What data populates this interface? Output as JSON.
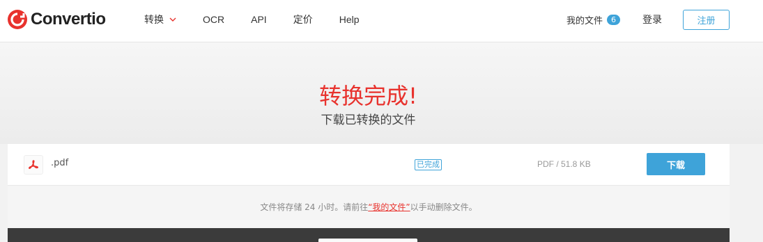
{
  "brand": {
    "name": "Convertio",
    "accent": "#e8322d"
  },
  "nav": {
    "items": [
      {
        "label": "转换",
        "has_dropdown": true
      },
      {
        "label": "OCR"
      },
      {
        "label": "API"
      },
      {
        "label": "定价"
      },
      {
        "label": "Help"
      }
    ]
  },
  "user_nav": {
    "my_files_label": "我的文件",
    "my_files_count": "6",
    "login_label": "登录",
    "signup_label": "注册"
  },
  "hero": {
    "title": "转换完成!",
    "subtitle": "下载已转换的文件"
  },
  "file": {
    "name": ".pdf",
    "icon": "pdf-icon",
    "status": "已完成",
    "meta": "PDF / 51.8 KB",
    "download_label": "下载"
  },
  "notice": {
    "before": "文件将存储 24 小时。请前往",
    "link": "“我的文件”",
    "after": "以手动删除文件。"
  },
  "colors": {
    "primary": "#3ea3d9",
    "danger": "#e8322d",
    "dark_band": "#3b3b3b"
  }
}
